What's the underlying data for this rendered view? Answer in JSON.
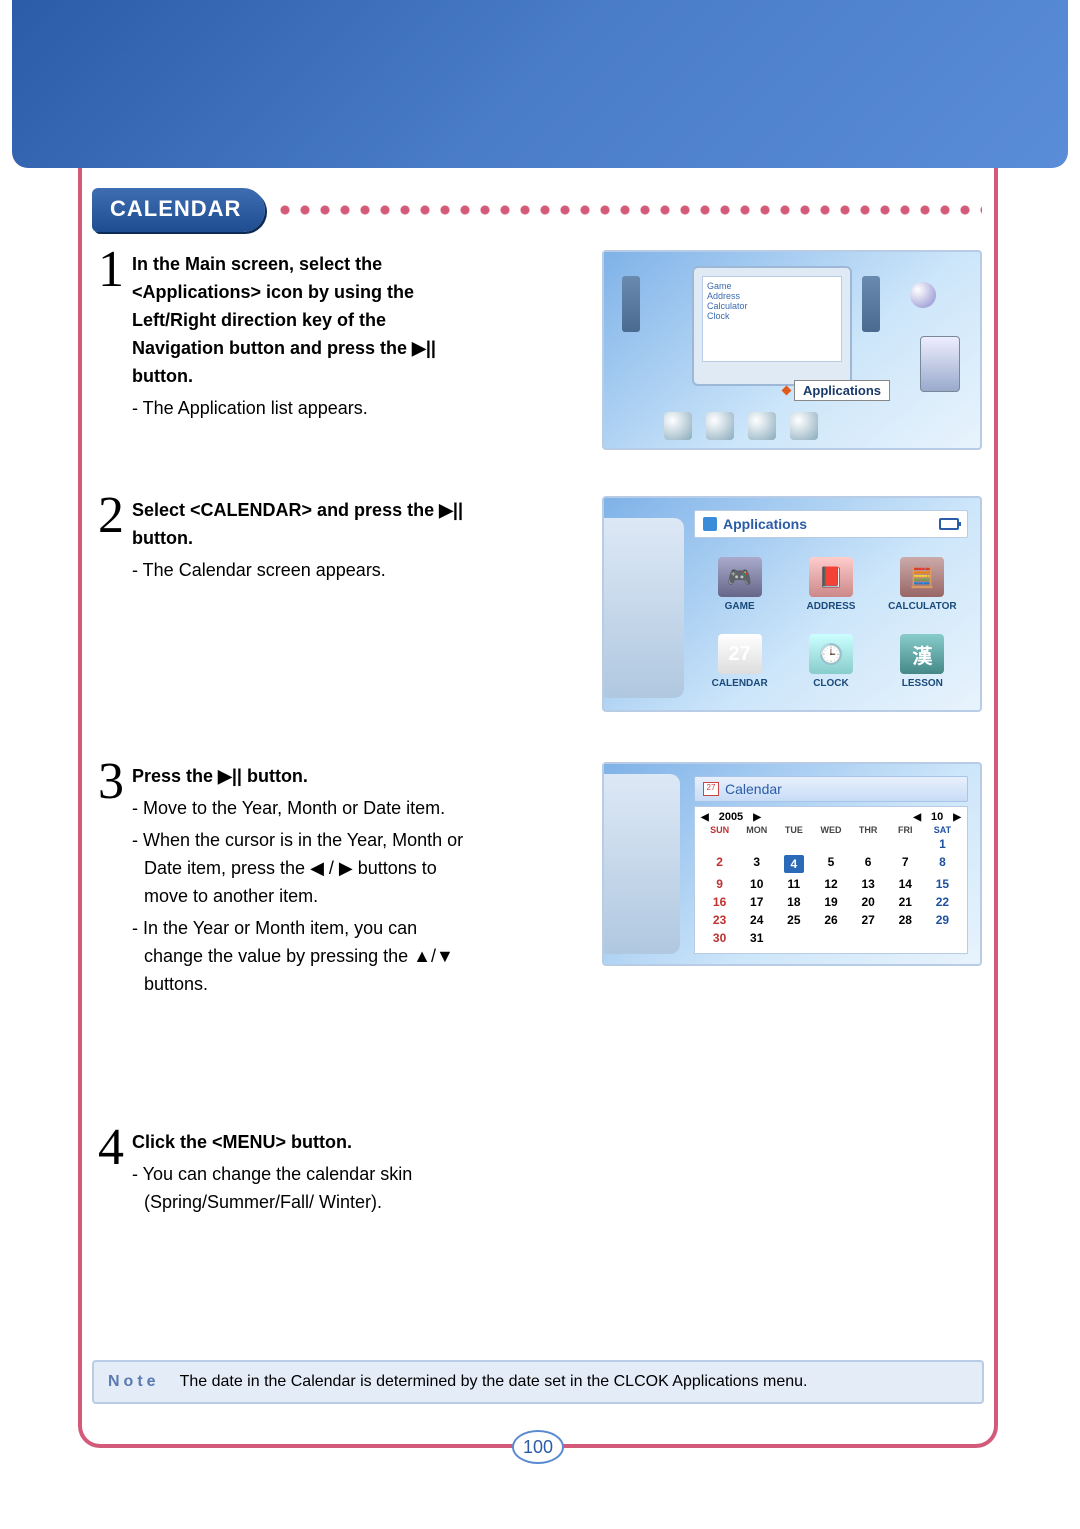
{
  "section_title": "CALENDAR",
  "page_number": "100",
  "steps": [
    {
      "num": "1",
      "title_parts": [
        "In the Main screen, select the <Applications> icon by using the Left/Right direction key of the Navigation button and press the ",
        "▶|| button."
      ],
      "bullets": [
        "The Application list appears."
      ]
    },
    {
      "num": "2",
      "title_parts": [
        "Select <CALENDAR> and press the ",
        "▶|| button."
      ],
      "bullets": [
        "The Calendar screen appears."
      ]
    },
    {
      "num": "3",
      "title_parts": [
        "Press the ",
        "▶|| button."
      ],
      "bullets": [
        "Move to the Year, Month or Date item.",
        "When the cursor is in the Year, Month or Date item, press the ◀ / ▶ buttons to move to another item.",
        "In the Year or Month item, you can change the value by pressing the ▲/▼ buttons."
      ]
    },
    {
      "num": "4",
      "title_parts": [
        "Click the <MENU> button."
      ],
      "bullets": [
        "You can change the calendar skin (Spring/Summer/Fall/ Winter)."
      ]
    }
  ],
  "note": {
    "label": "Note",
    "text": "The date in the Calendar is determined by the date set in the CLCOK Applications menu."
  },
  "fig1": {
    "tv_lines": [
      "Game",
      "Address",
      "Calculator",
      "Clock"
    ],
    "caption": "Applications"
  },
  "fig2": {
    "title": "Applications",
    "apps": [
      {
        "label": "GAME",
        "glyph": "🎮",
        "cls": "ic-game"
      },
      {
        "label": "ADDRESS",
        "glyph": "📕",
        "cls": "ic-addr"
      },
      {
        "label": "CALCULATOR",
        "glyph": "🧮",
        "cls": "ic-calc"
      },
      {
        "label": "CALENDAR",
        "glyph": "27",
        "cls": "ic-cal"
      },
      {
        "label": "CLOCK",
        "glyph": "🕒",
        "cls": "ic-clock"
      },
      {
        "label": "LESSON",
        "glyph": "漢",
        "cls": "ic-less"
      }
    ]
  },
  "fig3": {
    "title": "Calendar",
    "year": "2005",
    "month": "10",
    "dow": [
      "SUN",
      "MON",
      "TUE",
      "WED",
      "THR",
      "FRI",
      "SAT"
    ],
    "rows": [
      [
        "",
        "",
        "",
        "",
        "",
        "",
        "1"
      ],
      [
        "2",
        "3",
        "4",
        "5",
        "6",
        "7",
        "8"
      ],
      [
        "9",
        "10",
        "11",
        "12",
        "13",
        "14",
        "15"
      ],
      [
        "16",
        "17",
        "18",
        "19",
        "20",
        "21",
        "22"
      ],
      [
        "23",
        "24",
        "25",
        "26",
        "27",
        "28",
        "29"
      ],
      [
        "30",
        "31",
        "",
        "",
        "",
        "",
        ""
      ]
    ],
    "today": "4"
  }
}
